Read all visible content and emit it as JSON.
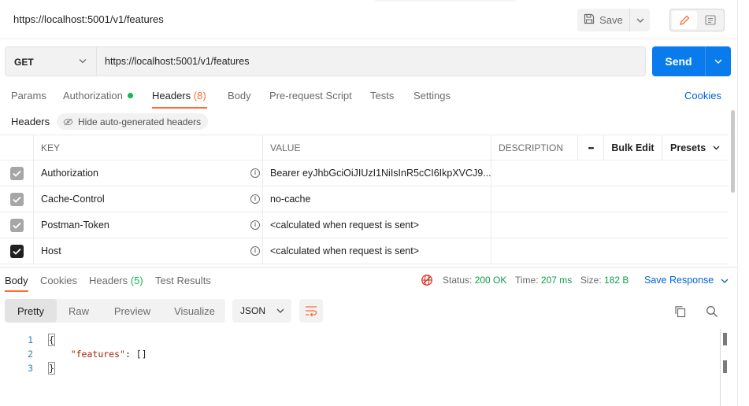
{
  "request": {
    "title": "https://localhost:5001/v1/features",
    "save_label": "Save",
    "method": "GET",
    "url": "https://localhost:5001/v1/features",
    "send_label": "Send"
  },
  "request_tabs": [
    {
      "label": "Params"
    },
    {
      "label": "Authorization"
    },
    {
      "label": "Headers",
      "count": "(8)"
    },
    {
      "label": "Body"
    },
    {
      "label": "Pre-request Script"
    },
    {
      "label": "Tests"
    },
    {
      "label": "Settings"
    }
  ],
  "cookies_label": "Cookies",
  "headers_section": {
    "label": "Headers",
    "hide_auto_label": "Hide auto-generated headers"
  },
  "table": {
    "columns": {
      "key": "KEY",
      "value": "VALUE",
      "description": "DESCRIPTION",
      "more": "•••",
      "bulk_edit": "Bulk Edit",
      "presets": "Presets"
    },
    "rows": [
      {
        "key": "Authorization",
        "value": "Bearer eyJhbGciOiJIUzI1NiIsInR5cCI6IkpXVCJ9...",
        "checked": true,
        "auto": true
      },
      {
        "key": "Cache-Control",
        "value": "no-cache",
        "checked": true,
        "auto": true
      },
      {
        "key": "Postman-Token",
        "value": "<calculated when request is sent>",
        "checked": true,
        "auto": true
      },
      {
        "key": "Host",
        "value": "<calculated when request is sent>",
        "checked": true,
        "auto": false
      }
    ]
  },
  "response_tabs": [
    {
      "label": "Body"
    },
    {
      "label": "Cookies"
    },
    {
      "label": "Headers",
      "count": "(5)"
    },
    {
      "label": "Test Results"
    }
  ],
  "response_status": {
    "status_label": "Status:",
    "status_value": "200 OK",
    "time_label": "Time:",
    "time_value": "207 ms",
    "size_label": "Size:",
    "size_value": "182 B",
    "save_response": "Save Response"
  },
  "view_modes": [
    "Pretty",
    "Raw",
    "Preview",
    "Visualize"
  ],
  "format": "JSON",
  "code_lines": [
    {
      "n": "1",
      "text": "{"
    },
    {
      "n": "2",
      "key": "\"features\"",
      "rest": ": []"
    },
    {
      "n": "3",
      "text": "}"
    }
  ],
  "colors": {
    "accent": "#ff6c37",
    "send": "#097bed",
    "link": "#0265d2",
    "success": "#0cbb52"
  }
}
